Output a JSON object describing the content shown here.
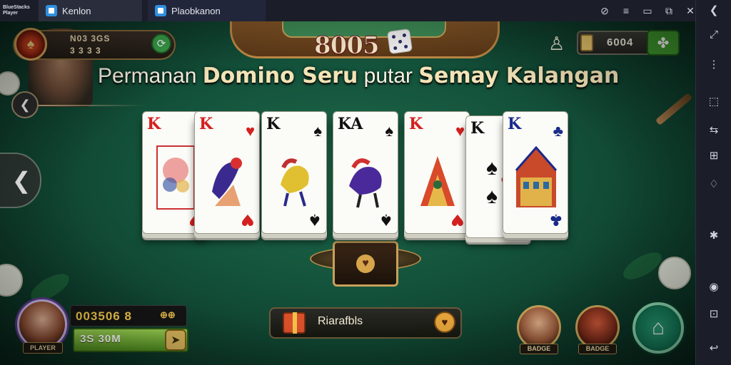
{
  "window": {
    "logo_lines": [
      "BlueStacks",
      "Player"
    ],
    "tabs": [
      {
        "label": "Kenlon"
      },
      {
        "label": "Plaobkanon"
      }
    ],
    "controls": [
      "⊘",
      "≡",
      "▭",
      "⧉",
      "✕"
    ]
  },
  "sidebar": {
    "buttons": [
      "❮",
      "⤢",
      "⋮",
      "⬚",
      "⇆",
      "⊞",
      "♢",
      "✱",
      "◉",
      "⊡",
      "↩"
    ]
  },
  "hud": {
    "score_display": "8005",
    "profile": {
      "name": "N03 3GS",
      "score": "3 3 3 3"
    },
    "banner": {
      "pre": "Permanan ",
      "bold1": "Domino Seru",
      "mid": " putar ",
      "bold2": "Semay Kalangan"
    },
    "coins": "6004",
    "back_icon": "❮",
    "prev_icon": "❮",
    "puzzle_icon": "✤",
    "person_icon": "♙"
  },
  "cards": [
    {
      "rank": "K",
      "suit": "♥",
      "color": "#d42020"
    },
    {
      "rank": "K",
      "suit": "♥",
      "color": "#d42020"
    },
    {
      "rank": "K",
      "suit": "♠",
      "color": "#111111"
    },
    {
      "rank": "KA",
      "suit": "♠",
      "color": "#111111"
    },
    {
      "rank": "K",
      "suit": "♥",
      "color": "#d42020"
    },
    {
      "rank": "K",
      "suit": "♣",
      "color": "#111111"
    },
    {
      "rank": "K",
      "suit": "♣",
      "color": "#1a2a8a"
    }
  ],
  "player": {
    "chips": "003506 8",
    "chip_icon": "⊕⊕",
    "bet": "3S 30M",
    "bet_button_icon": "➤",
    "avatar_label": "PLAYER"
  },
  "action": {
    "label": "Riarafbls",
    "badge_icon": "♥"
  },
  "opponents": [
    {
      "label": "BADGE"
    },
    {
      "label": "BADGE"
    }
  ],
  "home_icon": "⌂",
  "holder_icon": "♥",
  "colors": {
    "felt": "#13513a",
    "wood": "#8a5a2a",
    "gold": "#c8a05a",
    "green_button": "#3f9a2e"
  }
}
